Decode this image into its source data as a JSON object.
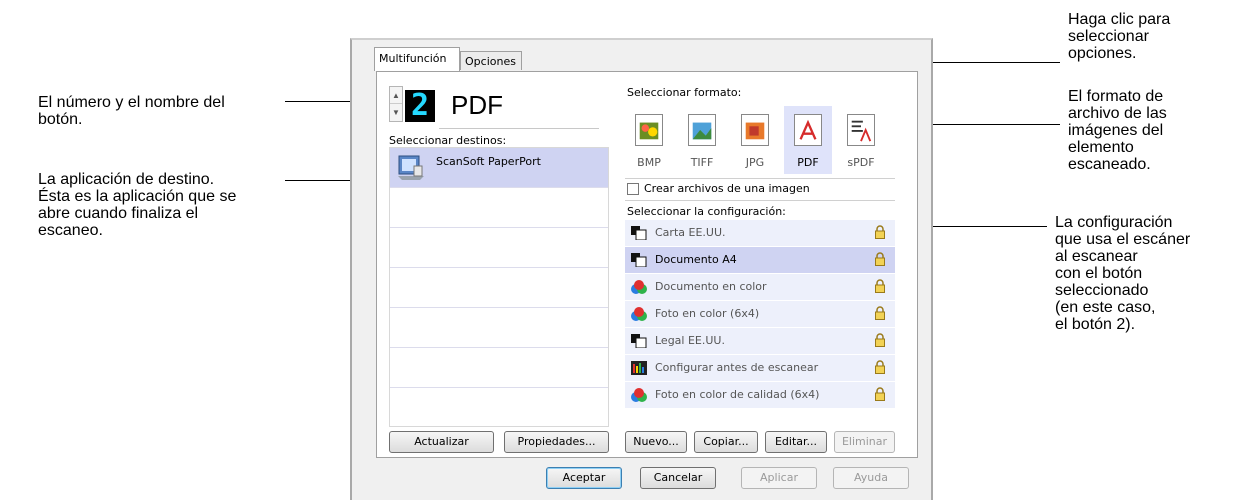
{
  "callouts": {
    "button_number": [
      "El número y el nombre del",
      "botón."
    ],
    "destination_app": [
      "La aplicación de destino.",
      "Ésta es la aplicación que se",
      "abre cuando finaliza el",
      "escaneo."
    ],
    "click_options": [
      "Haga clic para",
      "seleccionar",
      "opciones."
    ],
    "file_format": [
      "El formato de",
      "archivo de las",
      "imágenes del",
      "elemento",
      "escaneado."
    ],
    "settings": [
      "La configuración",
      "que usa el escáner",
      "al escanear",
      "con el botón",
      "seleccionado",
      "(en este caso,",
      "el botón 2)."
    ]
  },
  "tabs": [
    "Multifunción",
    "Opciones"
  ],
  "button_number": "2",
  "button_name": "PDF",
  "select_destinations_label": "Seleccionar destinos:",
  "destinations": [
    {
      "label": "ScanSoft PaperPort",
      "icon": "paperport-icon",
      "selected": true
    }
  ],
  "select_format_label": "Seleccionar formato:",
  "formats": [
    {
      "label": "BMP",
      "icon": "bmp-icon",
      "selected": false
    },
    {
      "label": "TIFF",
      "icon": "tiff-icon",
      "selected": false
    },
    {
      "label": "JPG",
      "icon": "jpg-icon",
      "selected": false
    },
    {
      "label": "PDF",
      "icon": "pdf-icon",
      "selected": true
    },
    {
      "label": "sPDF",
      "icon": "spdf-icon",
      "selected": false
    }
  ],
  "single_image_checkbox": {
    "label": "Crear archivos de una imagen",
    "checked": false
  },
  "select_config_label": "Seleccionar la configuración:",
  "configs": [
    {
      "label": "Carta EE.UU.",
      "icon": "bw-document-icon",
      "selected": false
    },
    {
      "label": "Documento A4",
      "icon": "bw-document-icon",
      "selected": true
    },
    {
      "label": "Documento en color",
      "icon": "color-document-icon",
      "selected": false
    },
    {
      "label": "Foto en color (6x4)",
      "icon": "color-document-icon",
      "selected": false
    },
    {
      "label": "Legal EE.UU.",
      "icon": "bw-document-icon",
      "selected": false
    },
    {
      "label": "Configurar antes de escanear",
      "icon": "configure-icon",
      "selected": false
    },
    {
      "label": "Foto en color de calidad (6x4)",
      "icon": "color-document-icon",
      "selected": false
    }
  ],
  "left_buttons": {
    "refresh": "Actualizar",
    "properties": "Propiedades..."
  },
  "right_buttons": {
    "new": "Nuevo...",
    "copy": "Copiar...",
    "edit": "Editar...",
    "delete": "Eliminar"
  },
  "dialog_buttons": {
    "ok": "Aceptar",
    "cancel": "Cancelar",
    "apply": "Aplicar",
    "help": "Ayuda"
  }
}
